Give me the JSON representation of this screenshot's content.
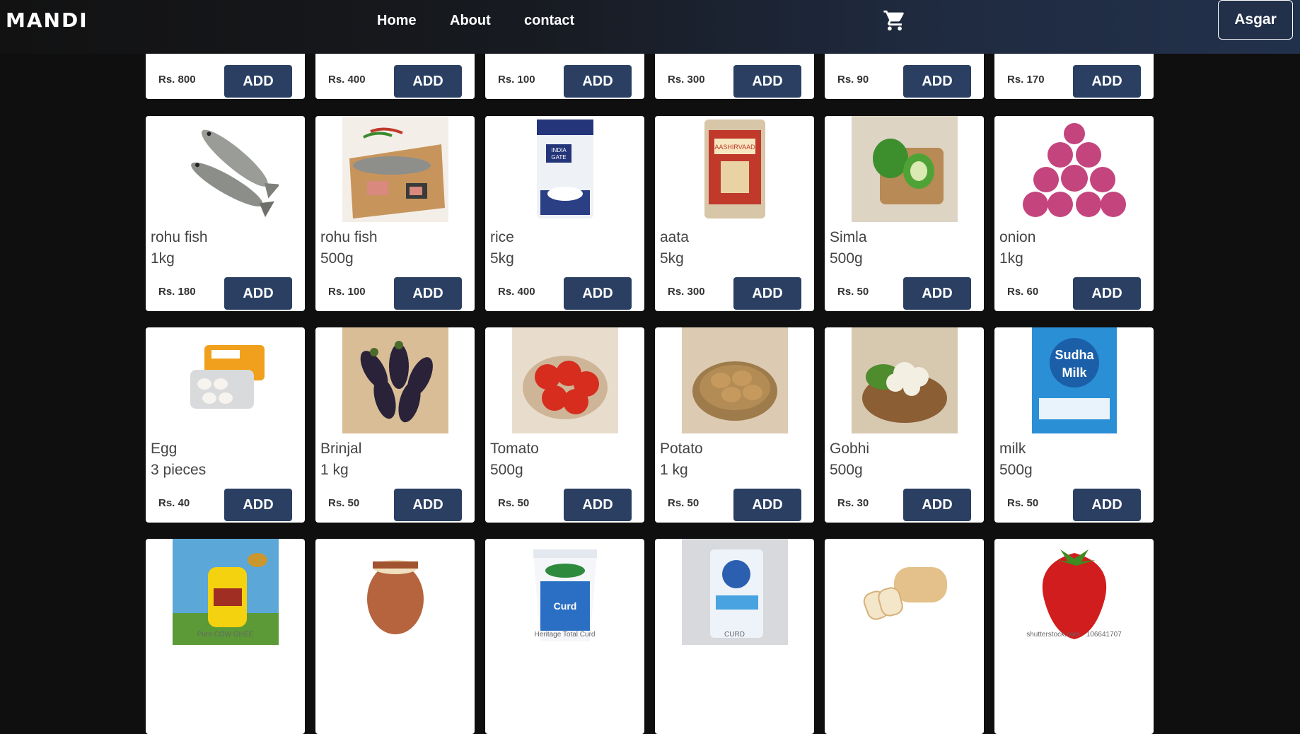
{
  "nav": {
    "logo": "MANDI",
    "links": [
      "Home",
      "About",
      "contact"
    ],
    "user": "Asgar"
  },
  "rows": [
    {
      "partial": true,
      "items": [
        {
          "name": "",
          "qty": "",
          "price": "Rs. 800",
          "add": "ADD"
        },
        {
          "name": "",
          "qty": "",
          "price": "Rs. 400",
          "add": "ADD"
        },
        {
          "name": "",
          "qty": "",
          "price": "Rs. 100",
          "add": "ADD"
        },
        {
          "name": "",
          "qty": "",
          "price": "Rs. 300",
          "add": "ADD"
        },
        {
          "name": "",
          "qty": "",
          "price": "Rs. 90",
          "add": "ADD"
        },
        {
          "name": "",
          "qty": "",
          "price": "Rs. 170",
          "add": "ADD"
        }
      ]
    },
    {
      "items": [
        {
          "name": "rohu fish",
          "qty": "1kg",
          "price": "Rs. 180",
          "add": "ADD",
          "icon": "fish-image"
        },
        {
          "name": "rohu fish",
          "qty": "500g",
          "price": "Rs. 100",
          "add": "ADD",
          "icon": "fish-board-image"
        },
        {
          "name": "rice",
          "qty": "5kg",
          "price": "Rs. 400",
          "add": "ADD",
          "icon": "rice-bag-image"
        },
        {
          "name": "aata",
          "qty": "5kg",
          "price": "Rs. 300",
          "add": "ADD",
          "icon": "aata-bag-image"
        },
        {
          "name": "Simla",
          "qty": "500g",
          "price": "Rs. 50",
          "add": "ADD",
          "icon": "capsicum-image"
        },
        {
          "name": "onion",
          "qty": "1kg",
          "price": "Rs. 60",
          "add": "ADD",
          "icon": "onion-image"
        }
      ]
    },
    {
      "items": [
        {
          "name": "Egg",
          "qty": "3 pieces",
          "price": "Rs. 40",
          "add": "ADD",
          "icon": "egg-image"
        },
        {
          "name": "Brinjal",
          "qty": "1 kg",
          "price": "Rs. 50",
          "add": "ADD",
          "icon": "brinjal-image"
        },
        {
          "name": "Tomato",
          "qty": "500g",
          "price": "Rs. 50",
          "add": "ADD",
          "icon": "tomato-image"
        },
        {
          "name": "Potato",
          "qty": "1 kg",
          "price": "Rs. 50",
          "add": "ADD",
          "icon": "potato-image"
        },
        {
          "name": "Gobhi",
          "qty": "500g",
          "price": "Rs. 30",
          "add": "ADD",
          "icon": "cauliflower-image"
        },
        {
          "name": "milk",
          "qty": "500g",
          "price": "Rs. 50",
          "add": "ADD",
          "icon": "milk-packet-image"
        }
      ]
    },
    {
      "partial_bottom": true,
      "items": [
        {
          "icon": "ghee-image",
          "label": "Pure COW GHEE"
        },
        {
          "icon": "lassi-image",
          "label": ""
        },
        {
          "icon": "curd-cup-image",
          "label": "Heritage Total Curd"
        },
        {
          "icon": "curd-packet-image",
          "label": "CURD"
        },
        {
          "icon": "bread-image",
          "label": ""
        },
        {
          "icon": "strawberry-image",
          "label": "shutterstock.com · 106641707"
        }
      ]
    }
  ]
}
